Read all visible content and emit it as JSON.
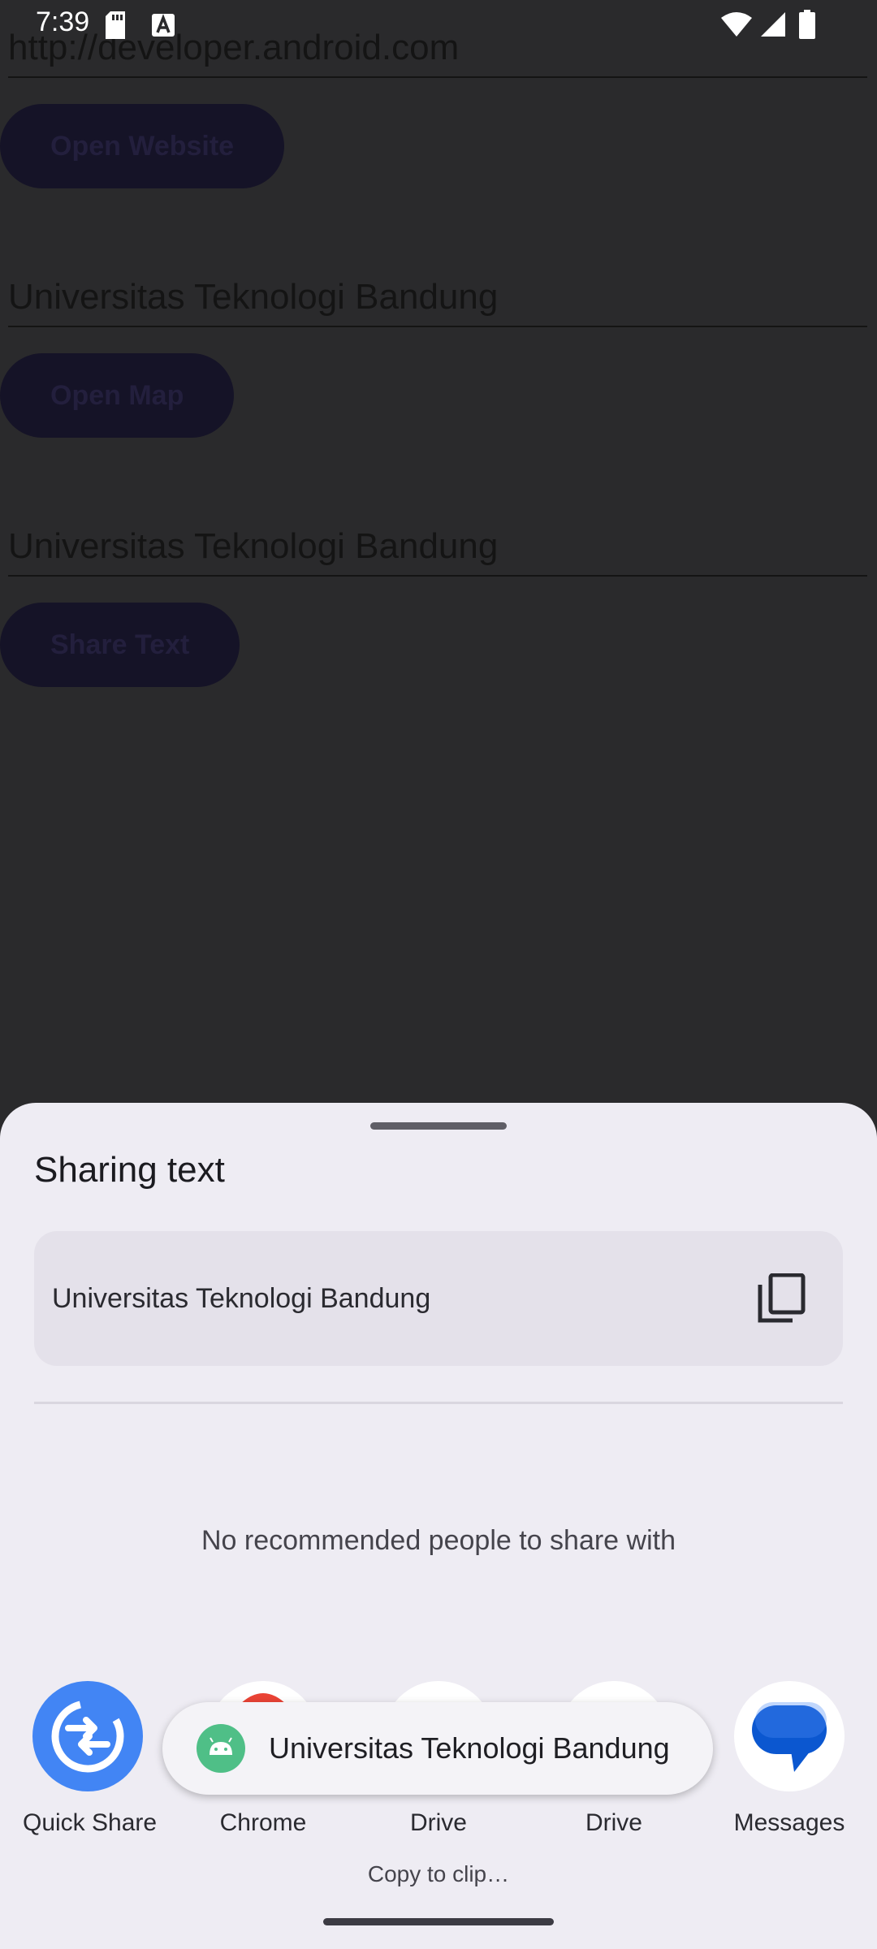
{
  "status_bar": {
    "time": "7:39"
  },
  "background_app": {
    "url_field": "http://developer.android.com",
    "open_website_button": "Open Website",
    "map_field": "Universitas Teknologi Bandung",
    "open_map_button": "Open Map",
    "share_field": "Universitas Teknologi Bandung",
    "share_text_button": "Share Text"
  },
  "share_sheet": {
    "title": "Sharing text",
    "preview_text": "Universitas Teknologi Bandung",
    "no_people": "No recommended people to share with",
    "targets": [
      {
        "label": "Quick Share",
        "icon": "quick-share-icon"
      },
      {
        "label": "Chrome",
        "icon": "chrome-icon"
      },
      {
        "label": "Drive",
        "icon": "drive-icon"
      },
      {
        "label": "Drive",
        "icon": "drive-icon"
      },
      {
        "label": "Messages",
        "icon": "messages-icon"
      }
    ],
    "drive_sublabel": "Copy to clip…"
  },
  "toast": {
    "text": "Universitas Teknologi Bandung"
  },
  "colors": {
    "quick_share_blue": "#4285f4",
    "messages_blue": "#0b57d0",
    "chrome_red": "#ea4335",
    "android_green": "#4fbf87"
  }
}
